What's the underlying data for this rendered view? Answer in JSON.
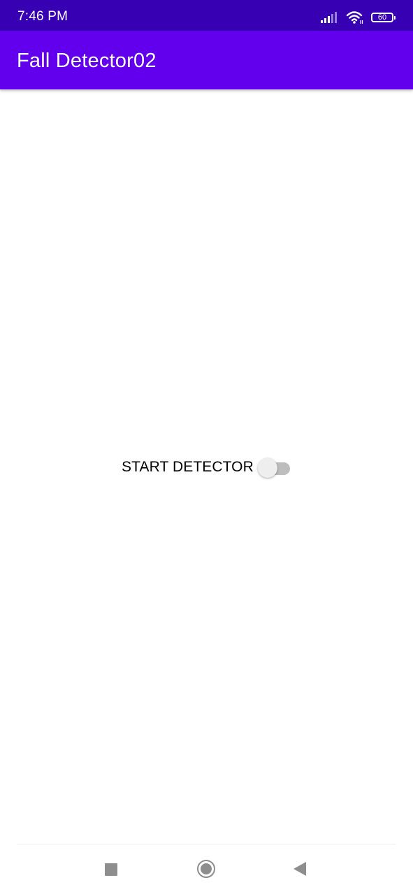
{
  "status_bar": {
    "time": "7:46 PM",
    "battery_level": "60",
    "icons": [
      "signal-icon",
      "wifi-icon",
      "battery-icon"
    ],
    "background": "#3700b3"
  },
  "app_bar": {
    "title": "Fall Detector02",
    "background": "#6200ee"
  },
  "main": {
    "switch": {
      "label": "START DETECTOR",
      "checked": false
    }
  },
  "nav_bar": {
    "buttons": [
      "recents-icon",
      "home-icon",
      "back-icon"
    ]
  }
}
